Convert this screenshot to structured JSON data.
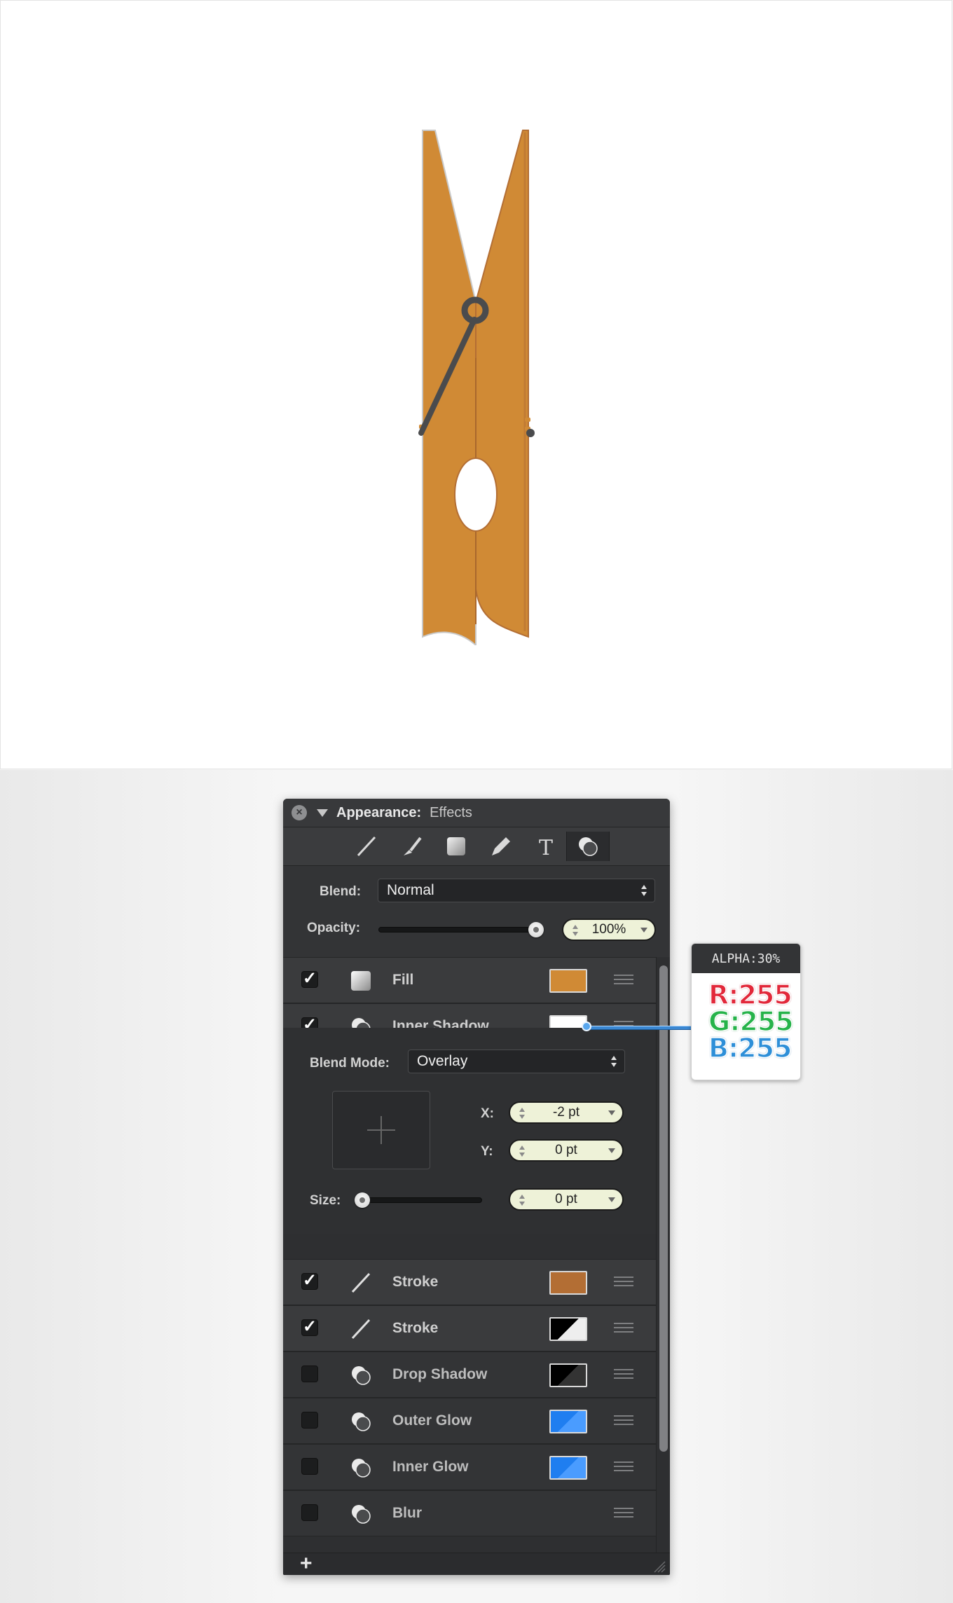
{
  "panel": {
    "title": "Appearance:",
    "subtitle": "Effects",
    "toolbar": [
      "line-tool-icon",
      "brush-tool-icon",
      "fill-tool-icon",
      "pen-tool-icon",
      "text-tool-icon",
      "effects-tool-icon"
    ],
    "blend_label": "Blend:",
    "blend_value": "Normal",
    "opacity_label": "Opacity:",
    "opacity_value": "100%",
    "opacity_level": 1.0,
    "effects": [
      {
        "label": "Fill",
        "checked": true,
        "swatch_color": "#d08a35",
        "icon": "fill-swatch-icon"
      },
      {
        "label": "Inner Shadow",
        "checked": true,
        "swatch_color": "#ffffff",
        "icon": "shadow-effect-icon"
      },
      {
        "label": "Stroke",
        "checked": true,
        "swatch_color": "#b36e34",
        "icon": "stroke-line-icon"
      },
      {
        "label": "Stroke",
        "checked": true,
        "swatch_color": "black-white-gradient",
        "icon": "stroke-line-icon"
      },
      {
        "label": "Drop Shadow",
        "checked": false,
        "swatch_color": "#000000",
        "icon": "shadow-effect-icon"
      },
      {
        "label": "Outer Glow",
        "checked": false,
        "swatch_color": "#1f7ef0",
        "icon": "glow-effect-icon"
      },
      {
        "label": "Inner Glow",
        "checked": false,
        "swatch_color": "#1f7ef0",
        "icon": "glow-effect-icon"
      },
      {
        "label": "Blur",
        "checked": false,
        "swatch_color": "",
        "icon": "blur-effect-icon"
      }
    ],
    "inner_shadow": {
      "blend_mode_label": "Blend Mode:",
      "blend_mode_value": "Overlay",
      "x_label": "X:",
      "x_value": "-2 pt",
      "y_label": "Y:",
      "y_value": "0 pt",
      "size_label": "Size:",
      "size_value": "0 pt",
      "size_level": 0.0
    },
    "add_label": "+"
  },
  "callout": {
    "alpha": "ALPHA:30%",
    "r": "R:255",
    "g": "G:255",
    "b": "B:255"
  },
  "colors": {
    "pin_orange": "#d08a35",
    "pin_stroke": "#b36e34",
    "spring": "#4a4b4d"
  }
}
